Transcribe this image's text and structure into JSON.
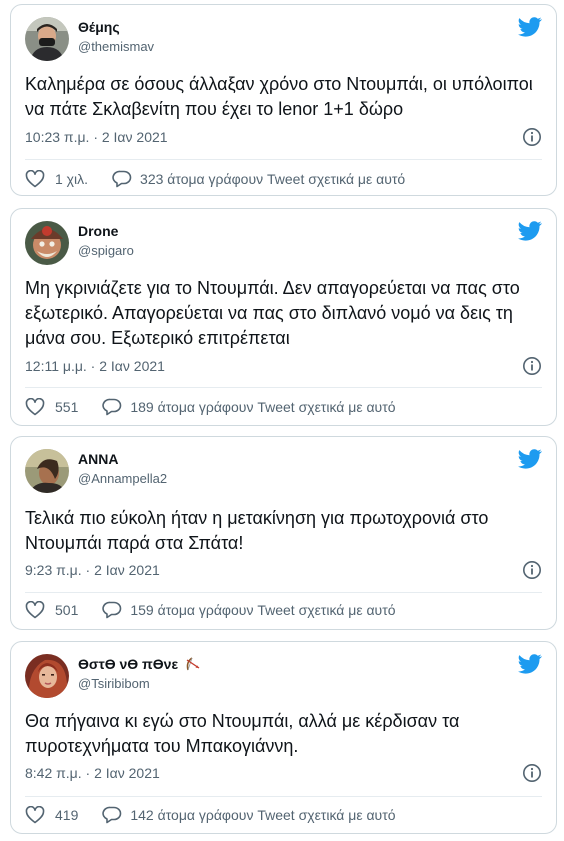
{
  "tweets": [
    {
      "name": "Θέμης",
      "handle": "@themismav",
      "text": "Καλημέρα σε όσους άλλαξαν χρόνο στο Ντουμπάι, οι υπόλοιποι να πάτε Σκλαβενίτη που έχει το lenor 1+1 δώρο",
      "time": "10:23 π.μ. · 2 Ιαν 2021",
      "likes": "1 χιλ.",
      "reply_label": "323 άτομα γράφουν Tweet σχετικά με αυτό"
    },
    {
      "name": "Drone",
      "handle": "@spigaro",
      "text": "Μη γκρινιάζετε για το Ντουμπάι. Δεν απαγορεύεται να πας στο εξωτερικό. Απαγορεύεται να πας στο διπλανό νομό να δεις τη μάνα σου. Εξωτερικό επιτρέπεται",
      "time": "12:11 μ.μ. · 2 Ιαν 2021",
      "likes": "551",
      "reply_label": "189 άτομα γράφουν Tweet σχετικά με αυτό"
    },
    {
      "name": "ANNA",
      "handle": "@Annampella2",
      "text": "Τελικά πιο εύκολη ήταν η μετακίνηση για πρωτοχρονιά στο Ντουμπάι  παρά στα Σπάτα!",
      "time": "9:23 π.μ. · 2 Ιαν 2021",
      "likes": "501",
      "reply_label": "159 άτομα γράφουν Tweet σχετικά με αυτό"
    },
    {
      "name": "ϴστϴ νϴ πϴνε",
      "handle": "@Tsiribibom",
      "text": "Θα πήγαινα κι εγώ στο Ντουμπάι, αλλά με κέρδισαν τα πυροτεχνήματα του Μπακογιάννη.",
      "time": "8:42 π.μ. · 2 Ιαν 2021",
      "likes": "419",
      "reply_label": "142 άτομα γράφουν Tweet σχετικά με αυτό"
    }
  ],
  "colors": {
    "twitter_blue": "#1d9bf0",
    "border": "#cfd9de",
    "secondary_text": "#536471",
    "primary_text": "#0f1419"
  },
  "icons": {
    "brand": "twitter-bird-icon",
    "info": "info-icon",
    "like": "heart-icon",
    "reply": "speech-bubble-icon",
    "name_emoji": "bow-and-arrow-icon"
  }
}
